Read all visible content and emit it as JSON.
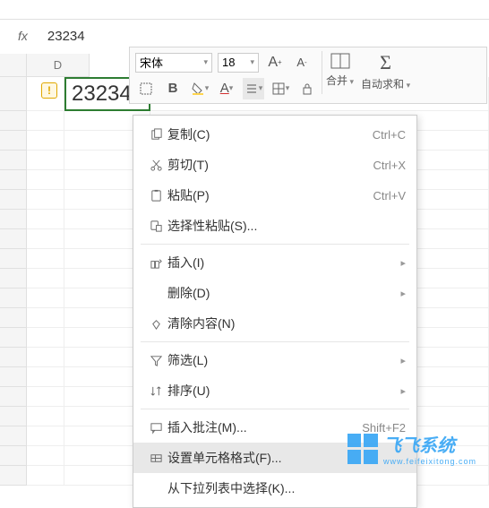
{
  "formula": {
    "value": "23234"
  },
  "ribbon": {
    "font": "宋体",
    "size": "18",
    "merge_label": "合并",
    "autosum_label": "自动求和"
  },
  "colheads": {
    "d": "D"
  },
  "cell": {
    "value": "23234"
  },
  "menu": {
    "copy": {
      "label": "复制(C)",
      "shortcut": "Ctrl+C"
    },
    "cut": {
      "label": "剪切(T)",
      "shortcut": "Ctrl+X"
    },
    "paste": {
      "label": "粘贴(P)",
      "shortcut": "Ctrl+V"
    },
    "paste_special": {
      "label": "选择性粘贴(S)..."
    },
    "insert": {
      "label": "插入(I)"
    },
    "delete": {
      "label": "删除(D)"
    },
    "clear": {
      "label": "清除内容(N)"
    },
    "filter": {
      "label": "筛选(L)"
    },
    "sort": {
      "label": "排序(U)"
    },
    "comment": {
      "label": "插入批注(M)...",
      "shortcut": "Shift+F2"
    },
    "format": {
      "label": "设置单元格格式(F)..."
    },
    "dropdown": {
      "label": "从下拉列表中选择(K)..."
    }
  },
  "watermark": {
    "text": "飞飞系统",
    "sub": "www.feifeixitong.com"
  }
}
